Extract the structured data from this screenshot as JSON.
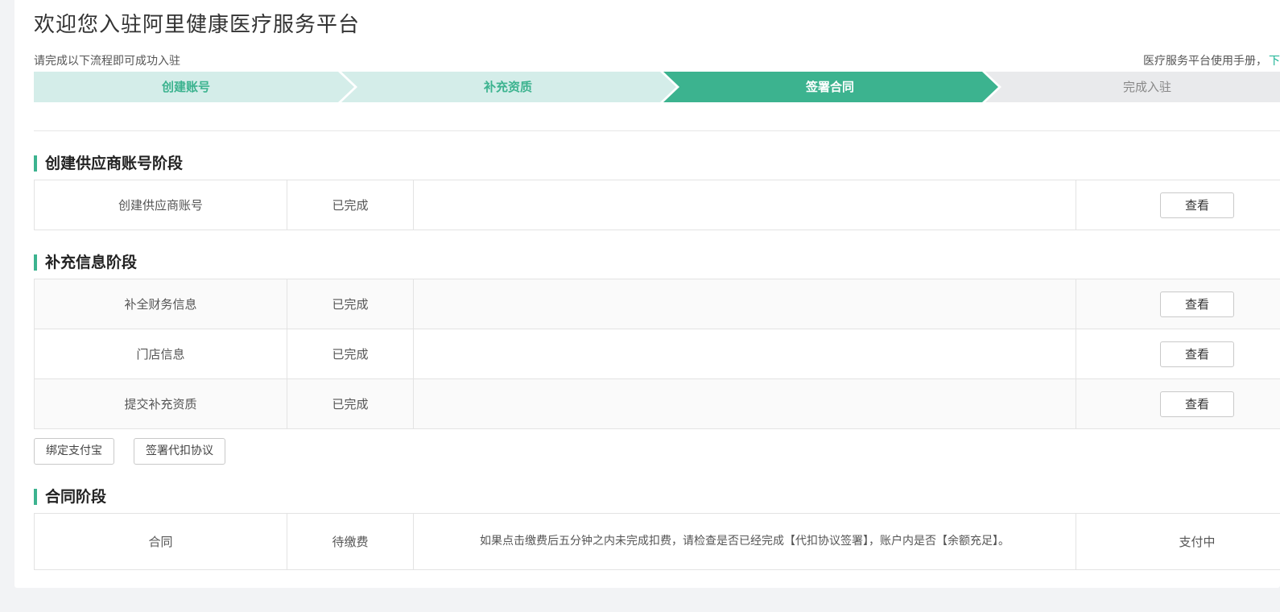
{
  "header": {
    "title": "欢迎您入驻阿里健康医疗服务平台",
    "subtitle": "请完成以下流程即可成功入驻",
    "manual_text": "医疗服务平台使用手册，",
    "manual_link": "下"
  },
  "steps": [
    {
      "label": "创建账号",
      "state": "done"
    },
    {
      "label": "补充资质",
      "state": "done"
    },
    {
      "label": "签署合同",
      "state": "active"
    },
    {
      "label": "完成入驻",
      "state": "pending"
    }
  ],
  "sections": {
    "account": {
      "title": "创建供应商账号阶段",
      "rows": [
        {
          "name": "创建供应商账号",
          "status": "已完成",
          "desc": "",
          "action": "查看"
        }
      ]
    },
    "supplement": {
      "title": "补充信息阶段",
      "rows": [
        {
          "name": "补全财务信息",
          "status": "已完成",
          "desc": "",
          "action": "查看"
        },
        {
          "name": "门店信息",
          "status": "已完成",
          "desc": "",
          "action": "查看"
        },
        {
          "name": "提交补充资质",
          "status": "已完成",
          "desc": "",
          "action": "查看"
        }
      ],
      "buttons": {
        "bind_alipay": "绑定支付宝",
        "sign_agreement": "签署代扣协议"
      }
    },
    "contract": {
      "title": "合同阶段",
      "rows": [
        {
          "name": "合同",
          "status": "待缴费",
          "desc": "如果点击缴费后五分钟之内未完成扣费，请检查是否已经完成【代扣协议签署】，账户内是否【余额充足】。",
          "action": "支付中"
        }
      ]
    }
  },
  "colors": {
    "step_done_bg": "#d4ede9",
    "step_done_text": "#3cb38f",
    "step_active_bg": "#3cb38f",
    "step_active_text": "#ffffff",
    "step_pending_bg": "#e9eaec",
    "step_pending_text": "#888888",
    "accent": "#3cb38f"
  }
}
